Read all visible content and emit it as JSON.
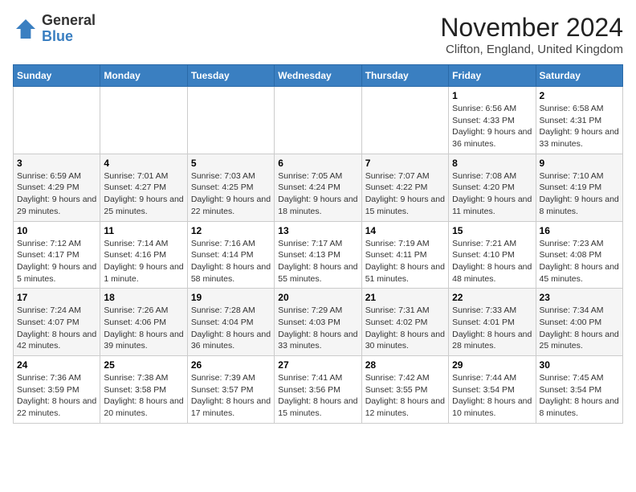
{
  "header": {
    "logo_general": "General",
    "logo_blue": "Blue",
    "month_title": "November 2024",
    "location": "Clifton, England, United Kingdom"
  },
  "days_of_week": [
    "Sunday",
    "Monday",
    "Tuesday",
    "Wednesday",
    "Thursday",
    "Friday",
    "Saturday"
  ],
  "weeks": [
    [
      {
        "day": "",
        "info": ""
      },
      {
        "day": "",
        "info": ""
      },
      {
        "day": "",
        "info": ""
      },
      {
        "day": "",
        "info": ""
      },
      {
        "day": "",
        "info": ""
      },
      {
        "day": "1",
        "info": "Sunrise: 6:56 AM\nSunset: 4:33 PM\nDaylight: 9 hours and 36 minutes."
      },
      {
        "day": "2",
        "info": "Sunrise: 6:58 AM\nSunset: 4:31 PM\nDaylight: 9 hours and 33 minutes."
      }
    ],
    [
      {
        "day": "3",
        "info": "Sunrise: 6:59 AM\nSunset: 4:29 PM\nDaylight: 9 hours and 29 minutes."
      },
      {
        "day": "4",
        "info": "Sunrise: 7:01 AM\nSunset: 4:27 PM\nDaylight: 9 hours and 25 minutes."
      },
      {
        "day": "5",
        "info": "Sunrise: 7:03 AM\nSunset: 4:25 PM\nDaylight: 9 hours and 22 minutes."
      },
      {
        "day": "6",
        "info": "Sunrise: 7:05 AM\nSunset: 4:24 PM\nDaylight: 9 hours and 18 minutes."
      },
      {
        "day": "7",
        "info": "Sunrise: 7:07 AM\nSunset: 4:22 PM\nDaylight: 9 hours and 15 minutes."
      },
      {
        "day": "8",
        "info": "Sunrise: 7:08 AM\nSunset: 4:20 PM\nDaylight: 9 hours and 11 minutes."
      },
      {
        "day": "9",
        "info": "Sunrise: 7:10 AM\nSunset: 4:19 PM\nDaylight: 9 hours and 8 minutes."
      }
    ],
    [
      {
        "day": "10",
        "info": "Sunrise: 7:12 AM\nSunset: 4:17 PM\nDaylight: 9 hours and 5 minutes."
      },
      {
        "day": "11",
        "info": "Sunrise: 7:14 AM\nSunset: 4:16 PM\nDaylight: 9 hours and 1 minute."
      },
      {
        "day": "12",
        "info": "Sunrise: 7:16 AM\nSunset: 4:14 PM\nDaylight: 8 hours and 58 minutes."
      },
      {
        "day": "13",
        "info": "Sunrise: 7:17 AM\nSunset: 4:13 PM\nDaylight: 8 hours and 55 minutes."
      },
      {
        "day": "14",
        "info": "Sunrise: 7:19 AM\nSunset: 4:11 PM\nDaylight: 8 hours and 51 minutes."
      },
      {
        "day": "15",
        "info": "Sunrise: 7:21 AM\nSunset: 4:10 PM\nDaylight: 8 hours and 48 minutes."
      },
      {
        "day": "16",
        "info": "Sunrise: 7:23 AM\nSunset: 4:08 PM\nDaylight: 8 hours and 45 minutes."
      }
    ],
    [
      {
        "day": "17",
        "info": "Sunrise: 7:24 AM\nSunset: 4:07 PM\nDaylight: 8 hours and 42 minutes."
      },
      {
        "day": "18",
        "info": "Sunrise: 7:26 AM\nSunset: 4:06 PM\nDaylight: 8 hours and 39 minutes."
      },
      {
        "day": "19",
        "info": "Sunrise: 7:28 AM\nSunset: 4:04 PM\nDaylight: 8 hours and 36 minutes."
      },
      {
        "day": "20",
        "info": "Sunrise: 7:29 AM\nSunset: 4:03 PM\nDaylight: 8 hours and 33 minutes."
      },
      {
        "day": "21",
        "info": "Sunrise: 7:31 AM\nSunset: 4:02 PM\nDaylight: 8 hours and 30 minutes."
      },
      {
        "day": "22",
        "info": "Sunrise: 7:33 AM\nSunset: 4:01 PM\nDaylight: 8 hours and 28 minutes."
      },
      {
        "day": "23",
        "info": "Sunrise: 7:34 AM\nSunset: 4:00 PM\nDaylight: 8 hours and 25 minutes."
      }
    ],
    [
      {
        "day": "24",
        "info": "Sunrise: 7:36 AM\nSunset: 3:59 PM\nDaylight: 8 hours and 22 minutes."
      },
      {
        "day": "25",
        "info": "Sunrise: 7:38 AM\nSunset: 3:58 PM\nDaylight: 8 hours and 20 minutes."
      },
      {
        "day": "26",
        "info": "Sunrise: 7:39 AM\nSunset: 3:57 PM\nDaylight: 8 hours and 17 minutes."
      },
      {
        "day": "27",
        "info": "Sunrise: 7:41 AM\nSunset: 3:56 PM\nDaylight: 8 hours and 15 minutes."
      },
      {
        "day": "28",
        "info": "Sunrise: 7:42 AM\nSunset: 3:55 PM\nDaylight: 8 hours and 12 minutes."
      },
      {
        "day": "29",
        "info": "Sunrise: 7:44 AM\nSunset: 3:54 PM\nDaylight: 8 hours and 10 minutes."
      },
      {
        "day": "30",
        "info": "Sunrise: 7:45 AM\nSunset: 3:54 PM\nDaylight: 8 hours and 8 minutes."
      }
    ]
  ]
}
